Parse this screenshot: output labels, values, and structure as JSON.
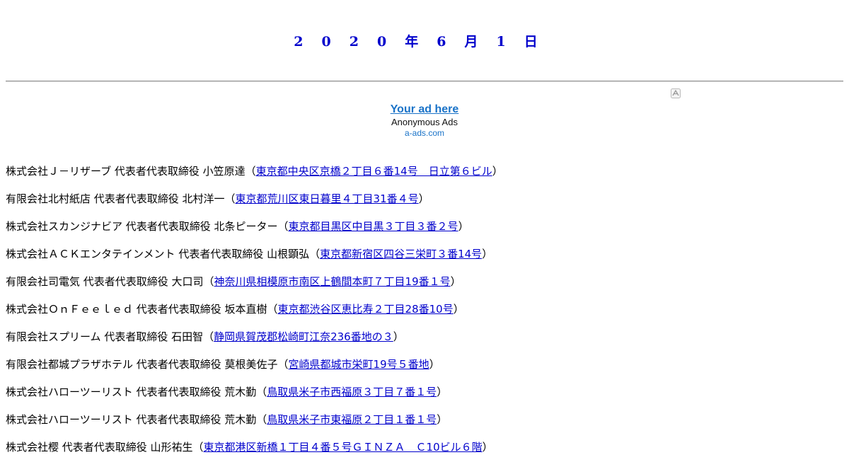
{
  "header": {
    "date_chars": [
      "2",
      "0",
      "2",
      "0",
      "年",
      "6",
      "月",
      "1",
      "日"
    ]
  },
  "ad": {
    "link": "Your ad here",
    "sub": "Anonymous Ads",
    "domain": "a-ads.com",
    "icon": "a-ads-logo-icon"
  },
  "entries": [
    {
      "text": "株式会社Ｊ－リザーブ 代表者代表取締役 小笠原達（",
      "address": "東京都中央区京橋２丁目６番14号　日立第６ビル",
      "close": "）"
    },
    {
      "text": "有限会社北村紙店 代表者代表取締役 北村洋一（",
      "address": "東京都荒川区東日暮里４丁目31番４号",
      "close": "）"
    },
    {
      "text": "株式会社スカンジナビア 代表者代表取締役 北条ピーター（",
      "address": "東京都目黒区中目黒３丁目３番２号",
      "close": "）"
    },
    {
      "text": "株式会社ＡＣＫエンタテインメント 代表者代表取締役 山根顕弘（",
      "address": "東京都新宿区四谷三栄町３番14号",
      "close": "）"
    },
    {
      "text": "有限会社司電気 代表者代表取締役 大口司（",
      "address": "神奈川県相模原市南区上鶴間本町７丁目19番１号",
      "close": "）"
    },
    {
      "text": "株式会社ＯｎＦｅｅｌｅｄ 代表者代表取締役 坂本直樹（",
      "address": "東京都渋谷区恵比寿２丁目28番10号",
      "close": "）"
    },
    {
      "text": "有限会社スプリーム 代表者取締役 石田智（",
      "address": "静岡県賀茂郡松崎町江奈236番地の３",
      "close": "）"
    },
    {
      "text": "有限会社都城プラザホテル 代表者代表取締役 莫根美佐子（",
      "address": "宮崎県都城市栄町19号５番地",
      "close": "）"
    },
    {
      "text": "株式会社ハローツーリスト 代表者代表取締役 荒木勤（",
      "address": "鳥取県米子市西福原３丁目７番１号",
      "close": "）"
    },
    {
      "text": "株式会社ハローツーリスト 代表者代表取締役 荒木勤（",
      "address": "鳥取県米子市東福原２丁目１番１号",
      "close": "）"
    },
    {
      "text": "株式会社樱 代表者代表取締役 山形祐生（",
      "address": "東京都港区新橋１丁目４番５号ＧＩＮＺＡ　Ｃ10ビル６階",
      "close": "）"
    }
  ]
}
